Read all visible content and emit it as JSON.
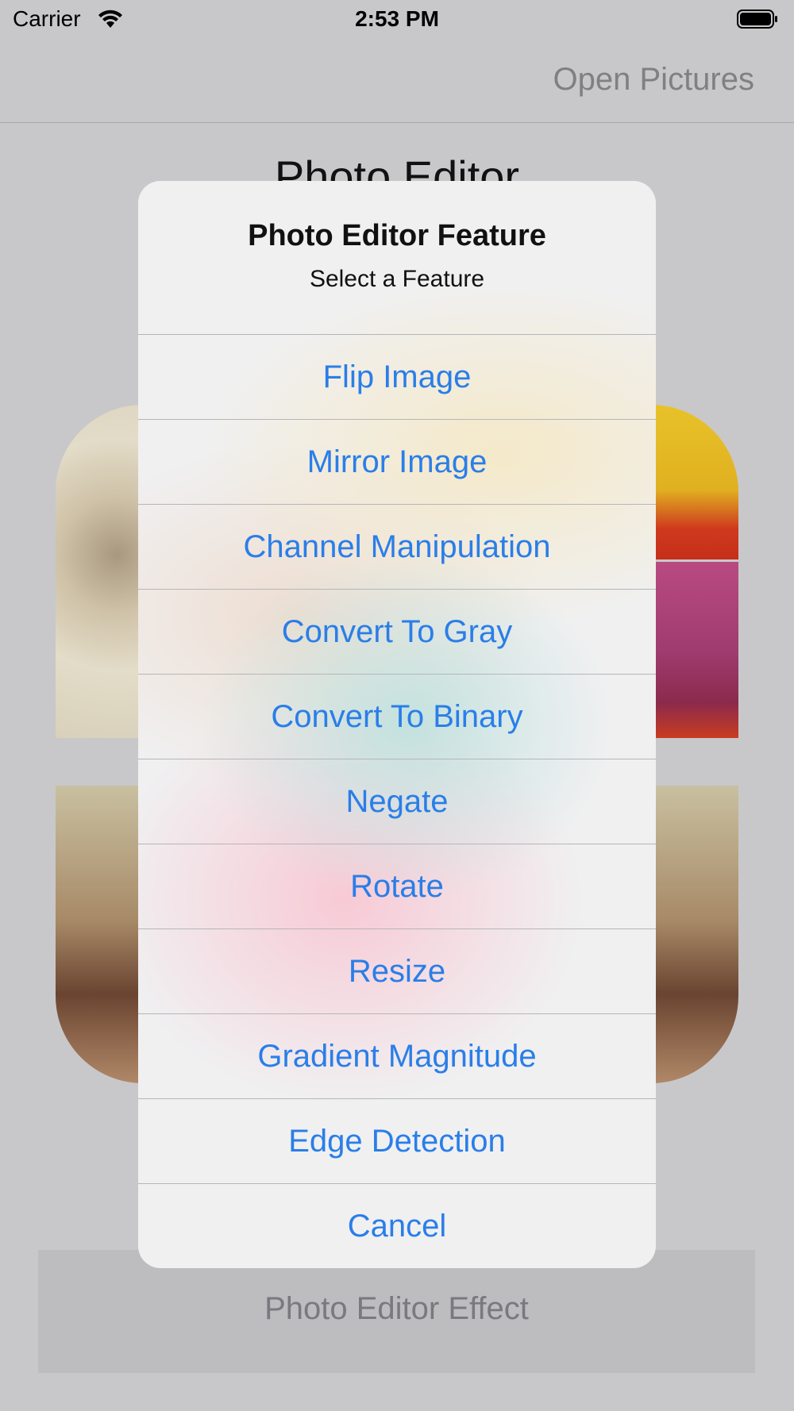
{
  "status_bar": {
    "carrier": "Carrier",
    "time": "2:53 PM"
  },
  "navbar": {
    "open_pictures": "Open Pictures"
  },
  "app": {
    "title": "Photo Editor",
    "effect_button": "Photo Editor Effect"
  },
  "action_sheet": {
    "title": "Photo Editor Feature",
    "subtitle": "Select a Feature",
    "options": [
      "Flip Image",
      "Mirror Image",
      "Channel Manipulation",
      "Convert To Gray",
      "Convert To Binary",
      "Negate",
      "Rotate",
      "Resize",
      "Gradient Magnitude",
      "Edge Detection"
    ],
    "cancel": "Cancel"
  },
  "colors": {
    "action_blue": "#2a7ee8",
    "dim_background": "#c8c8ca"
  }
}
